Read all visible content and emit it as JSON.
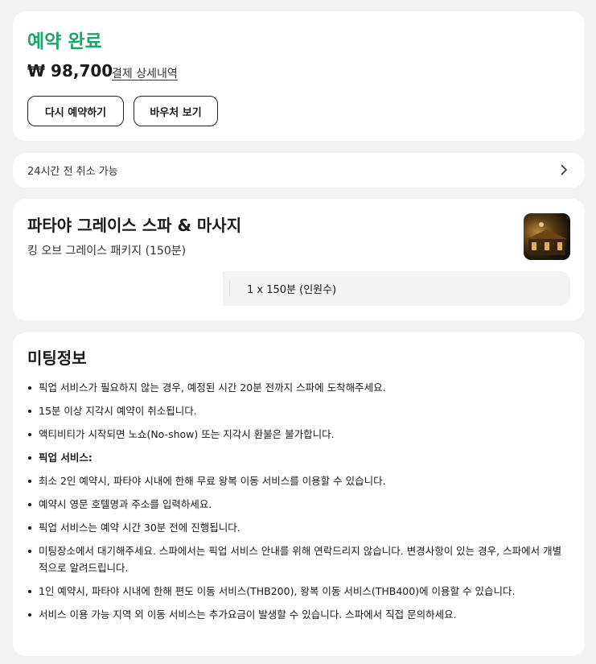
{
  "booking": {
    "status_title": "예약 완료",
    "price": "₩ 98,700",
    "payment_detail_link": "결제 상세내역",
    "rebook_button": "다시 예약하기",
    "voucher_button": "바우처 보기"
  },
  "cancellation": {
    "text": "24시간 전 취소 가능",
    "icon": "chevron-right-icon"
  },
  "product": {
    "title": "파타야 그레이스 스파 & 마사지",
    "package": "킹 오브 그레이스 패키지 (150분)",
    "quantity": "1 x 150분 (인원수)",
    "thumbnail": "spa-thumbnail-image"
  },
  "meeting": {
    "title": "미팅정보",
    "notes": [
      "픽업 서비스가 필요하지 않는 경우, 예정된 시간 20분 전까지 스파에 도착해주세요.",
      "15분 이상 지각시 예약이 취소됩니다.",
      "액티비티가 시작되면 노쇼(No-show) 또는 지각시 환불은 불가합니다.",
      "픽업 서비스:",
      "최소 2인 예약시, 파타야 시내에 한해 무료 왕복 이동 서비스를 이용할 수 있습니다.",
      "예약시 영문 호텔명과 주소를 입력하세요.",
      "픽업 서비스는 예약 시간 30분 전에 진행됩니다.",
      "미팅장소에서 대기해주세요. 스파에서는 픽업 서비스 안내를 위해 연락드리지 않습니다. 변경사항이 있는 경우, 스파에서 개별적으로 알려드립니다.",
      "1인 예약시, 파타야 시내에 한해 편도 이동 서비스(THB200), 왕복 이동 서비스(THB400)에 이용할 수 있습니다.",
      "서비스 이용 가능 지역 외 이동 서비스는 추가요금이 발생할 수 있습니다. 스파에서 직접 문의하세요."
    ]
  },
  "colors": {
    "accent_green": "#1fa56a",
    "background": "#f2f2f2"
  }
}
